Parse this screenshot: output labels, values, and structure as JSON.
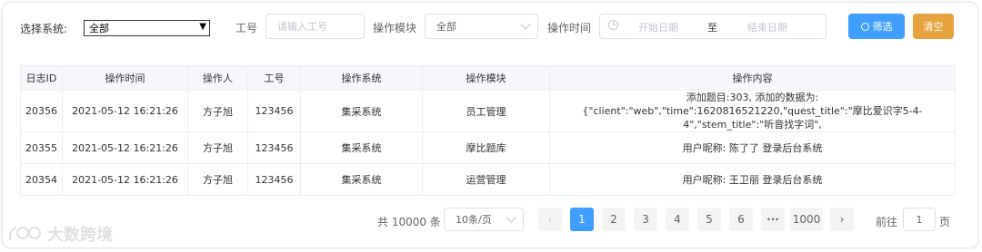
{
  "filters": {
    "system_label": "选择系统:",
    "system_value": "全部",
    "staff_no_label": "工号",
    "staff_no_placeholder": "请输入工号",
    "module_label": "操作模块",
    "module_value": "全部",
    "time_label": "操作时间",
    "start_placeholder": "开始日期",
    "range_sep": "至",
    "end_placeholder": "结束日期",
    "filter_button": "筛选",
    "clear_button": "清空"
  },
  "table": {
    "columns": [
      "日志ID",
      "操作时间",
      "操作人",
      "工号",
      "操作系统",
      "操作模块",
      "操作内容"
    ],
    "rows": [
      {
        "id": "20356",
        "time": "2021-05-12 16:21:26",
        "operator": "方子旭",
        "staff_no": "123456",
        "system": "集采系统",
        "module": "员工管理",
        "content": "添加题目:303, 添加的数据为: {\"client\":\"web\",\"time\":1620816521220,\"quest_title\":\"摩比爱识字5-4-4\",\"stem_title\":\"听音找字词\","
      },
      {
        "id": "20355",
        "time": "2021-05-12 16:21:26",
        "operator": "方子旭",
        "staff_no": "123456",
        "system": "集采系统",
        "module": "摩比题库",
        "content": "用户昵称: 陈了了 登录后台系统"
      },
      {
        "id": "20354",
        "time": "2021-05-12 16:21:26",
        "operator": "方子旭",
        "staff_no": "123456",
        "system": "集采系统",
        "module": "运营管理",
        "content": "用户昵称: 王卫丽 登录后台系统"
      }
    ]
  },
  "pagination": {
    "total_text": "共 10000 条",
    "page_size": "10条/页",
    "prev": "‹",
    "pages": [
      "1",
      "2",
      "3",
      "4",
      "5",
      "6"
    ],
    "ellipsis": "···",
    "last_page": "1000",
    "next": "›",
    "goto_label": "前往",
    "goto_value": "1",
    "goto_suffix": "页",
    "active_page": "1"
  },
  "watermark": {
    "text": "大数跨境"
  },
  "colors": {
    "primary": "#409eff",
    "warning": "#e6a23c",
    "border": "#dcdfe6",
    "header_bg": "#f5f7fa"
  }
}
